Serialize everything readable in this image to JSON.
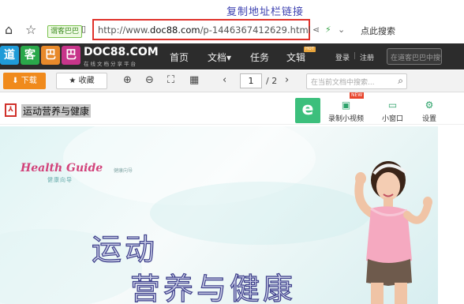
{
  "annotation": "复制地址栏链接",
  "browser": {
    "badge": "谓客巴巴",
    "url_prefix": "http://www.",
    "url_host": "doc88.com",
    "url_path": "/p-1446367412629.html",
    "right_label": "点此搜索"
  },
  "site": {
    "logo_chars": [
      "道",
      "客",
      "巴",
      "巴"
    ],
    "logo_colors": [
      "#1f9bd8",
      "#2aa84a",
      "#e8892a",
      "#c7358a"
    ],
    "name": "DOC88.COM",
    "slogan": "在线文档分享平台",
    "nav": [
      "首页",
      "文档▾",
      "任务",
      "文辑"
    ],
    "nav_badge": "HOT",
    "login": "登录",
    "register": "注册",
    "search_placeholder": "在道客巴巴中搜索"
  },
  "toolbar": {
    "download": "下载",
    "favorite": "收藏",
    "page_current": "1",
    "page_total": "/ 2",
    "search_placeholder": "在当前文档中搜索..."
  },
  "document": {
    "title": "运动营养与健康",
    "tools": [
      {
        "label": "录制小视频",
        "icon": "video-icon"
      },
      {
        "label": "小窗口",
        "icon": "window-icon"
      },
      {
        "label": "设置",
        "icon": "gear-icon"
      }
    ],
    "new_tag": "NEW",
    "cover_title": "Health Guide",
    "cover_brand": "健康向导",
    "cover_sub": "健康向导",
    "cover_line1": "运动",
    "cover_line2": "营养与健康"
  }
}
